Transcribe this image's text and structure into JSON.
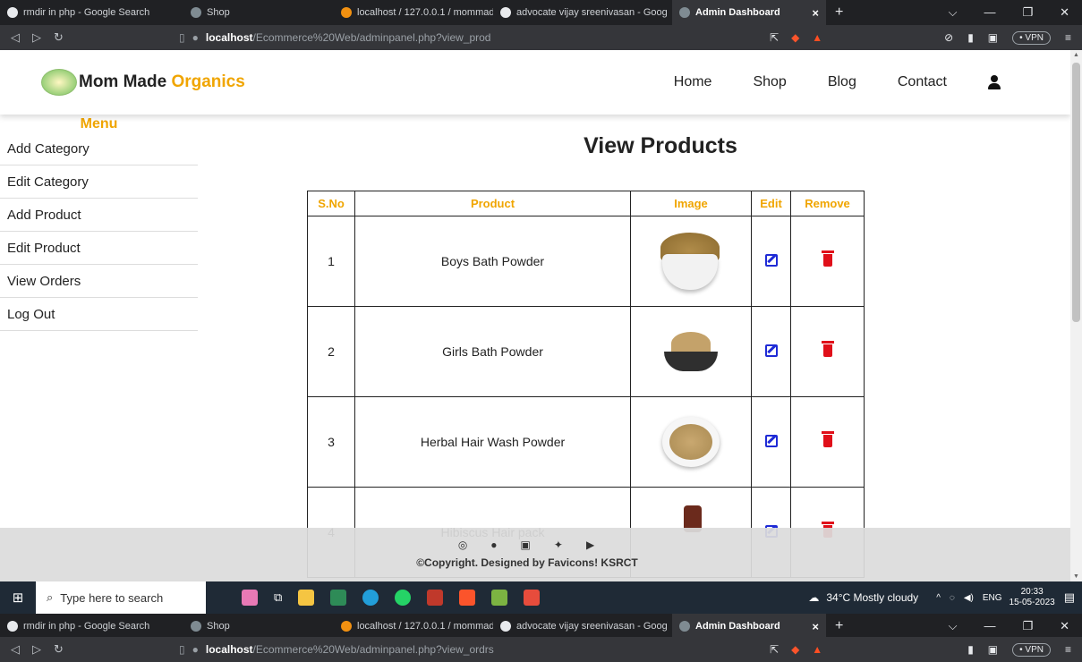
{
  "browser": {
    "tabs": [
      {
        "title": "rmdir in php - Google Search",
        "fav": "#e8eaed"
      },
      {
        "title": "Shop",
        "fav": "#7f8b92"
      },
      {
        "title": "localhost / 127.0.0.1 / mommadeo",
        "fav": "#f29111"
      },
      {
        "title": "advocate vijay sreenivasan - Goog",
        "fav": "#e8eaed"
      },
      {
        "title": "Admin Dashboard",
        "fav": "#7f8b92"
      }
    ],
    "url_host": "localhost",
    "url_path": "/Ecommerce%20Web/adminpanel.php?view_prod",
    "url_path_2": "/Ecommerce%20Web/adminpanel.php?view_ordrs",
    "vpn_label": "• VPN"
  },
  "header": {
    "brand_main": "Mom Made ",
    "brand_accent": "Organics",
    "nav": [
      "Home",
      "Shop",
      "Blog",
      "Contact"
    ]
  },
  "sidebar": {
    "title": "Menu",
    "items": [
      "Add Category",
      "Edit Category",
      "Add Product",
      "Edit Product",
      "View Orders",
      "Log Out"
    ]
  },
  "main": {
    "title": "View Products",
    "columns": [
      "S.No",
      "Product",
      "Image",
      "Edit",
      "Remove"
    ],
    "rows": [
      {
        "sno": "1",
        "product": "Boys Bath Powder"
      },
      {
        "sno": "2",
        "product": "Girls Bath Powder"
      },
      {
        "sno": "3",
        "product": "Herbal Hair Wash Powder"
      },
      {
        "sno": "4",
        "product": "Hibiscus Hair pack"
      }
    ]
  },
  "footer": {
    "copyright": "©Copyright. Designed by Favicons! KSRCT"
  },
  "taskbar": {
    "search_placeholder": "Type here to search",
    "weather": "34°C  Mostly cloudy",
    "lang": "ENG",
    "time": "20:33",
    "date": "15-05-2023"
  },
  "colors": {
    "accent": "#f0a500",
    "edit": "#1f2bd6",
    "delete": "#e0101a"
  }
}
